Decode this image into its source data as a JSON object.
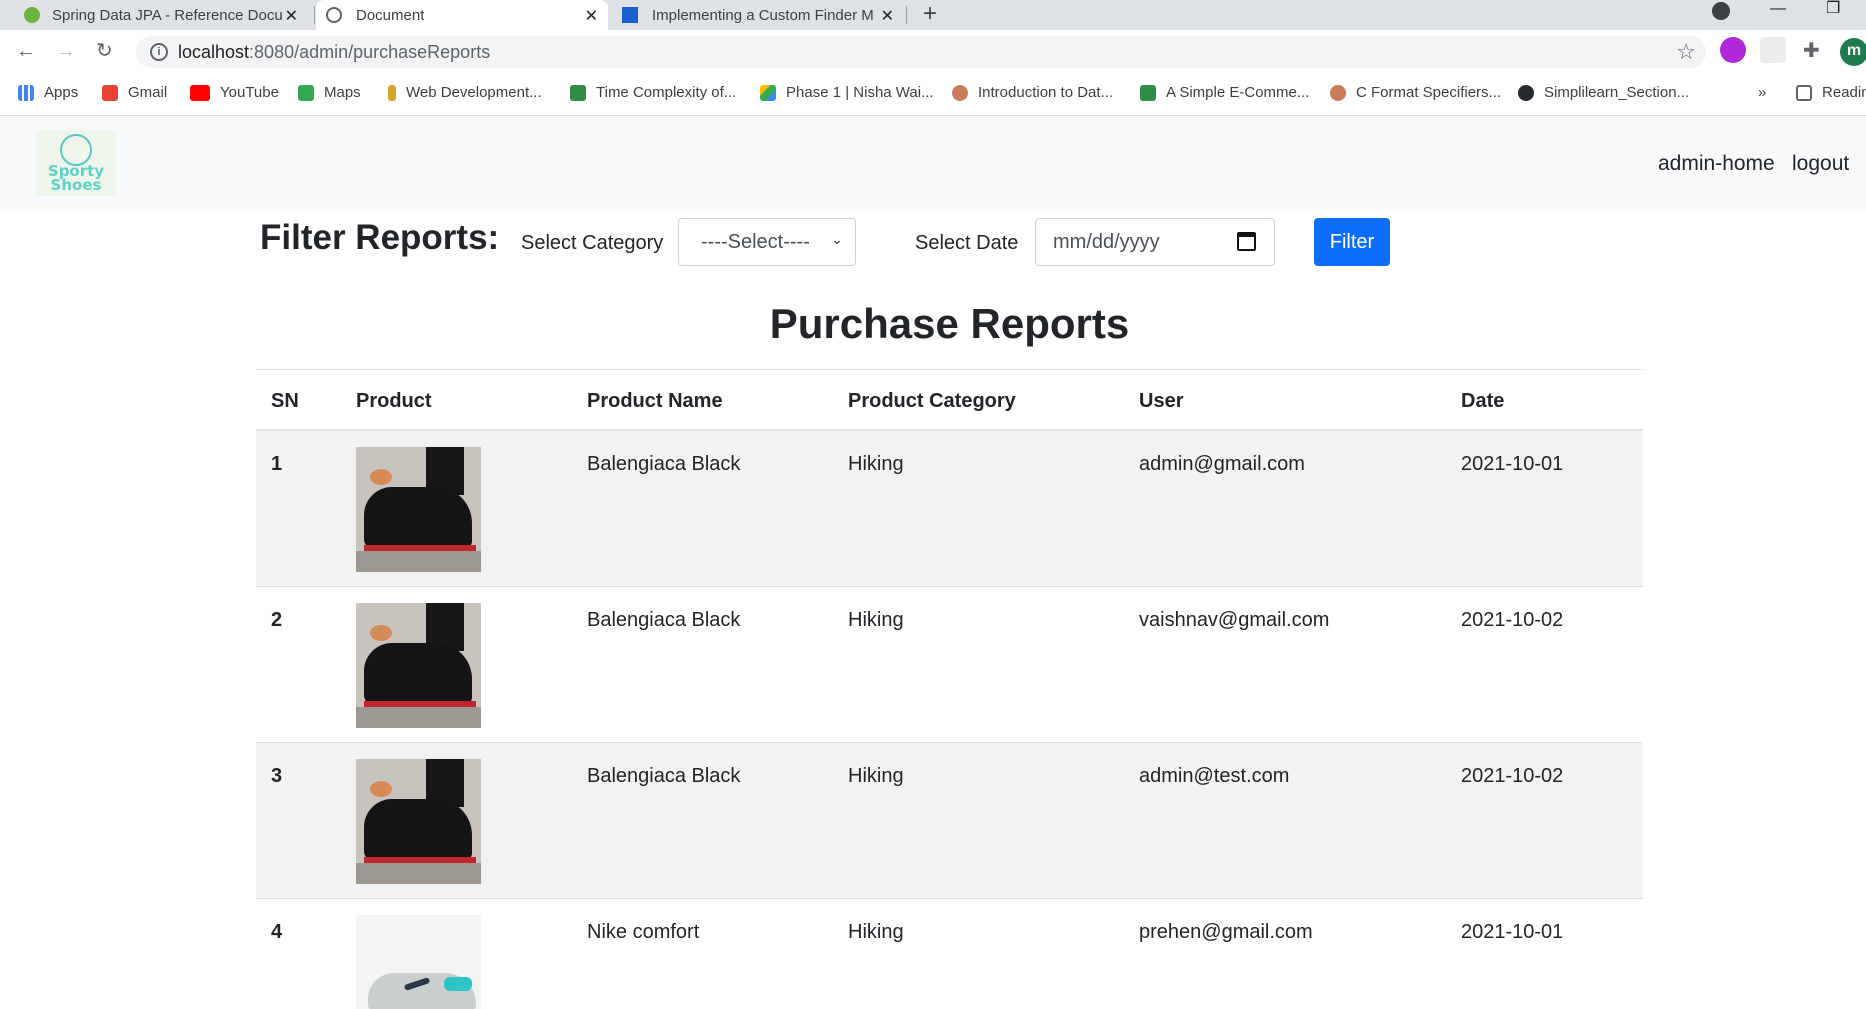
{
  "browser": {
    "tabs": [
      {
        "title": "Spring Data JPA - Reference Docu",
        "icon": "spring-leaf-icon"
      },
      {
        "title": "Document",
        "icon": "globe-icon"
      },
      {
        "title": "Implementing a Custom Finder M",
        "icon": "grid-icon"
      }
    ],
    "url_host": "localhost",
    "url_path": ":8080/admin/purchaseReports",
    "profile_initial": "m",
    "bookmarks": [
      {
        "label": "Apps",
        "icon": "apps-grid-icon"
      },
      {
        "label": "Gmail",
        "icon": "gmail-icon"
      },
      {
        "label": "YouTube",
        "icon": "youtube-icon"
      },
      {
        "label": "Maps",
        "icon": "maps-icon"
      },
      {
        "label": "Web Development...",
        "icon": "bookmark-site-icon"
      },
      {
        "label": "Time Complexity of...",
        "icon": "leaf-icon"
      },
      {
        "label": "Phase 1 | Nisha Wai...",
        "icon": "drive-icon"
      },
      {
        "label": "Introduction to Dat...",
        "icon": "avatar-icon"
      },
      {
        "label": "A Simple E-Comme...",
        "icon": "leaf-icon"
      },
      {
        "label": "C Format Specifiers...",
        "icon": "avatar-icon"
      },
      {
        "label": "Simplilearn_Section...",
        "icon": "github-icon"
      }
    ],
    "more_bookmarks": "»",
    "reading_list": "Readin"
  },
  "navbar": {
    "logo_text": "Sporty Shoes",
    "links": [
      "admin-home",
      "logout"
    ]
  },
  "filter": {
    "heading": "Filter Reports:",
    "category_label": "Select Category",
    "category_value": "----Select----",
    "date_label": "Select Date",
    "date_placeholder": "mm/dd/yyyy",
    "button": "Filter"
  },
  "report": {
    "title": "Purchase Reports",
    "columns": [
      "SN",
      "Product",
      "Product Name",
      "Product Category",
      "User",
      "Date"
    ],
    "rows": [
      {
        "sn": "1",
        "image": "black-sneaker",
        "name": "Balengiaca Black",
        "category": "Hiking",
        "user": "admin@gmail.com",
        "date": "2021-10-01"
      },
      {
        "sn": "2",
        "image": "black-sneaker",
        "name": "Balengiaca Black",
        "category": "Hiking",
        "user": "vaishnav@gmail.com",
        "date": "2021-10-02"
      },
      {
        "sn": "3",
        "image": "black-sneaker",
        "name": "Balengiaca Black",
        "category": "Hiking",
        "user": "admin@test.com",
        "date": "2021-10-02"
      },
      {
        "sn": "4",
        "image": "white-nike-shoe",
        "name": "Nike comfort",
        "category": "Hiking",
        "user": "prehen@gmail.com",
        "date": "2021-10-01"
      }
    ]
  },
  "colors": {
    "primary": "#0d6efd",
    "navbar_bg": "#f8f9fa",
    "stripe": "#f2f2f2"
  }
}
